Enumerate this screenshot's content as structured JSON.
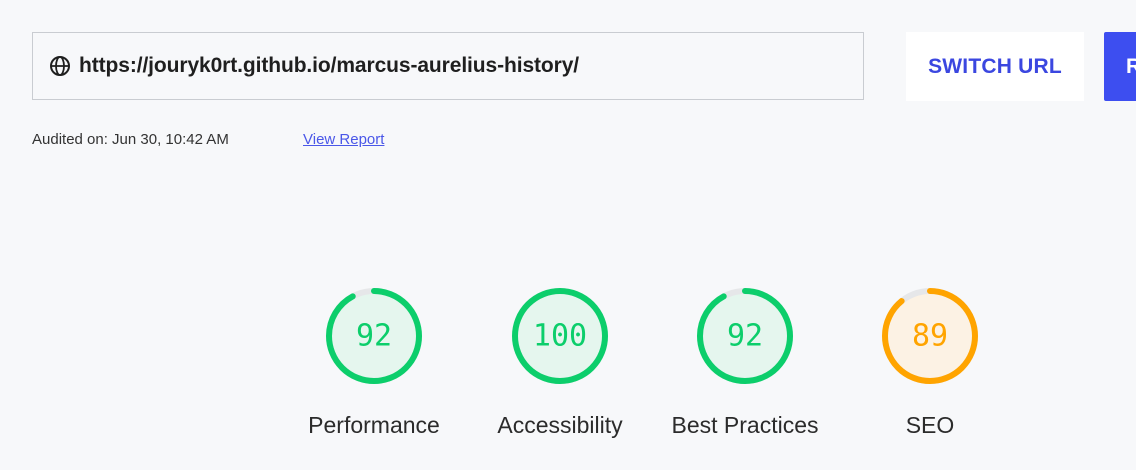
{
  "url_bar": {
    "icon": "globe-icon",
    "url": "https://jouryk0rt.github.io/marcus-aurelius-history/"
  },
  "buttons": {
    "switch_url": "SWITCH URL",
    "run_partial": "R"
  },
  "meta": {
    "audited_on": "Audited on: Jun 30, 10:42 AM",
    "view_report": "View Report"
  },
  "colors": {
    "good": "#0cce6b",
    "good_fill": "#e5f6ee",
    "average": "#ffa400",
    "average_fill": "#fcf2e4",
    "track": "#e6e7e9",
    "accent": "#3d4ef0"
  },
  "scores": [
    {
      "label": "Performance",
      "score": "92",
      "value": 92,
      "status": "good"
    },
    {
      "label": "Accessibility",
      "score": "100",
      "value": 100,
      "status": "good"
    },
    {
      "label": "Best Practices",
      "score": "92",
      "value": 92,
      "status": "good"
    },
    {
      "label": "SEO",
      "score": "89",
      "value": 89,
      "status": "average"
    }
  ]
}
